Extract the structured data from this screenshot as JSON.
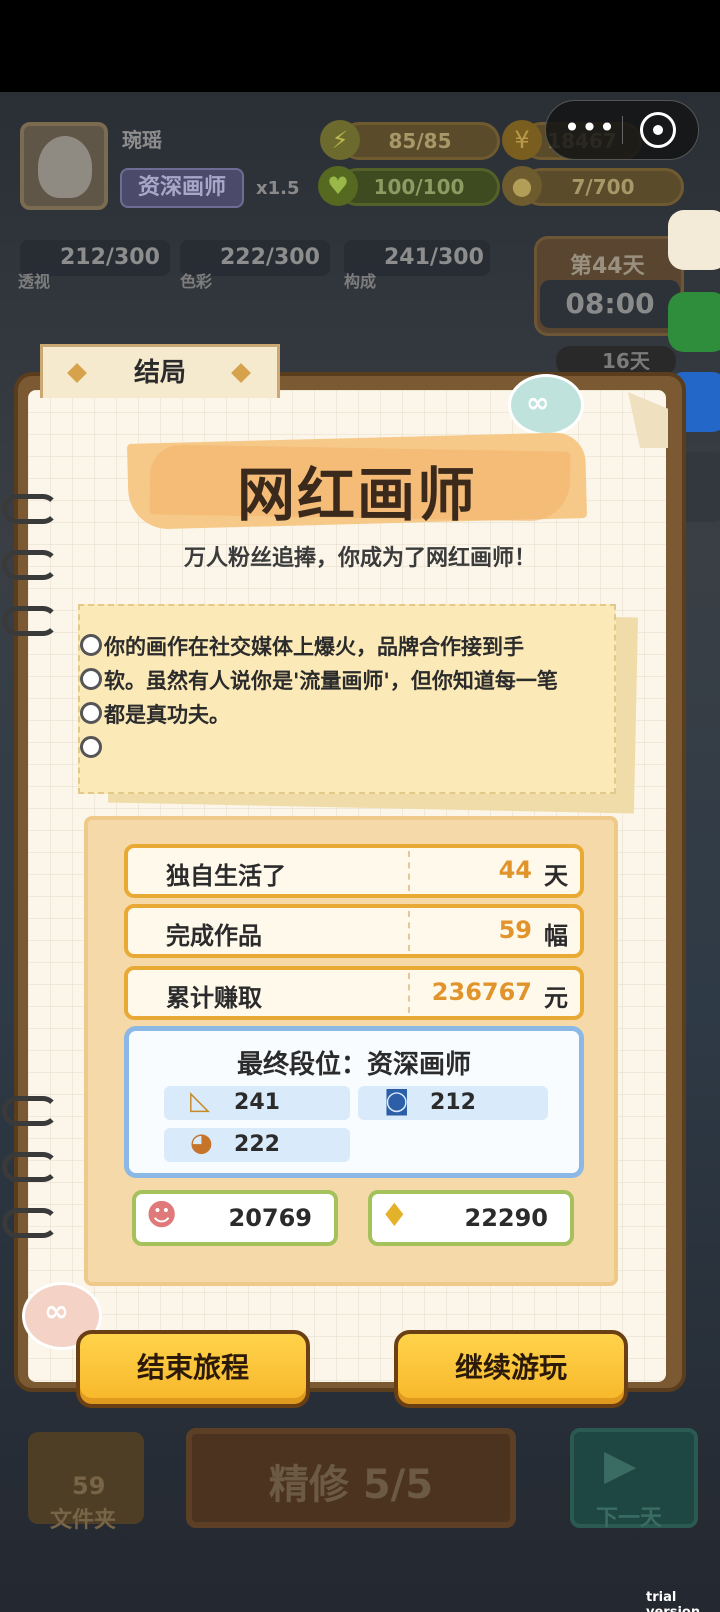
{
  "player": {
    "name": "琬瑶",
    "rank": "资深画师",
    "multiplier": "x1.5"
  },
  "resources": {
    "energy": "85/85",
    "coins": "18467",
    "health": "100/100",
    "ideas": "7/700"
  },
  "skills": {
    "perspective": {
      "value": "212/300",
      "label": "透视"
    },
    "color": {
      "value": "222/300",
      "label": "色彩"
    },
    "composition": {
      "value": "241/300",
      "label": "构成"
    }
  },
  "day": {
    "label": "第44天",
    "clock": "08:00",
    "remaining": "16天"
  },
  "capsule": {
    "more": "•••"
  },
  "modal": {
    "tab_title": "结局",
    "ending_title": "网红画师",
    "ending_subtitle": "万人粉丝追捧，你成为了网红画师！",
    "story_lines": [
      "你的画作在社交媒体上爆火，品牌合作接到手",
      "软。虽然有人说你是'流量画师'，但你知道每一笔",
      "都是真功夫。"
    ],
    "stats": [
      {
        "label": "独自生活了",
        "value": "44",
        "unit": "天"
      },
      {
        "label": "完成作品",
        "value": "59",
        "unit": "幅"
      },
      {
        "label": "累计赚取",
        "value": "236767",
        "unit": "元"
      }
    ],
    "final_rank": "最终段位：资深画师",
    "rank_skills": {
      "perspective": "241",
      "composition": "212",
      "color": "222"
    },
    "fans": "20769",
    "likes": "22290",
    "buttons": {
      "end_journey": "结束旅程",
      "continue": "继续游玩"
    }
  },
  "bottom": {
    "folder_count": "59",
    "folder_label": "文件夹",
    "polish": "精修 5/5",
    "next_day": "下一天"
  },
  "watermark": "trial version",
  "icons": {
    "energy": "lightning-icon",
    "coins": "coin-icon",
    "health": "heart-icon",
    "ideas": "lightbulb-icon",
    "perspective": "ruler-triangle-icon",
    "color": "palette-icon",
    "composition": "camera-icon",
    "fans": "people-icon",
    "likes": "thumbs-up-icon"
  },
  "colors": {
    "accent_orange": "#e2942c",
    "button_yellow": "#ffd34a",
    "rank_blue_border": "#8cb8e5",
    "counter_green_border": "#a4c15b"
  }
}
